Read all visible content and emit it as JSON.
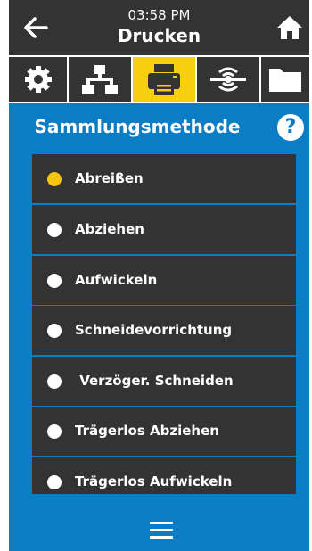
{
  "header": {
    "time": "03:58 PM",
    "title": "Drucken",
    "back_icon": "arrow-left-icon",
    "home_icon": "home-icon"
  },
  "tabs": [
    {
      "name": "settings",
      "icon": "gear-icon",
      "active": false
    },
    {
      "name": "network",
      "icon": "network-icon",
      "active": false
    },
    {
      "name": "print",
      "icon": "printer-icon",
      "active": true
    },
    {
      "name": "rfid",
      "icon": "rfid-icon",
      "active": false
    },
    {
      "name": "storage",
      "icon": "folder-icon",
      "active": false
    }
  ],
  "section": {
    "title": "Sammlungsmethode",
    "help_icon": "?"
  },
  "options": [
    {
      "label": "Abreißen",
      "selected": true
    },
    {
      "label": "Abziehen",
      "selected": false
    },
    {
      "label": "Aufwickeln",
      "selected": false
    },
    {
      "label": "Schneidevorrichtung",
      "selected": false
    },
    {
      "label": " Verzöger. Schneiden",
      "selected": false
    },
    {
      "label": "Trägerlos Abziehen",
      "selected": false
    },
    {
      "label": "Trägerlos Aufwickeln",
      "selected": false
    }
  ],
  "footer": {
    "menu_icon": "hamburger-menu-icon"
  },
  "colors": {
    "background": "#0b7dc4",
    "dark": "#333333",
    "accent": "#f7cf10"
  }
}
